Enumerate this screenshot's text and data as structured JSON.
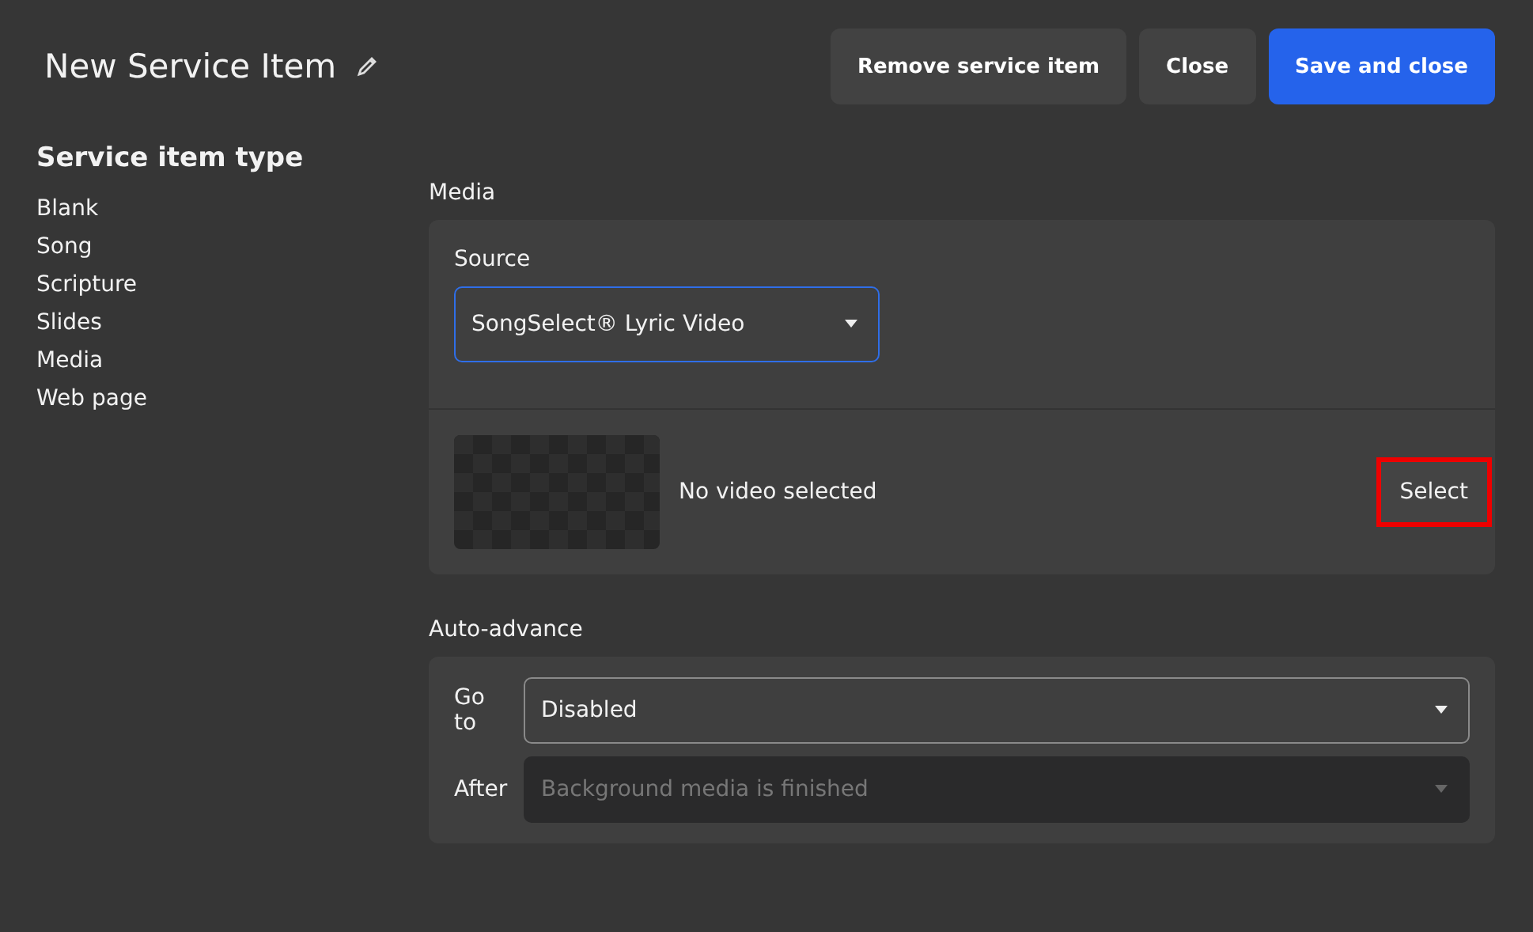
{
  "header": {
    "title": "New Service Item",
    "buttons": [
      {
        "label": "Remove service item",
        "kind": "secondary"
      },
      {
        "label": "Close",
        "kind": "secondary"
      },
      {
        "label": "Save and close",
        "kind": "primary"
      }
    ]
  },
  "sidebar": {
    "heading": "Service item type",
    "items": [
      "Blank",
      "Song",
      "Scripture",
      "Slides",
      "Media",
      "Web page"
    ]
  },
  "media": {
    "label": "Media",
    "source": {
      "label": "Source",
      "value": "SongSelect® Lyric Video",
      "focused": true
    },
    "video": {
      "status": "No video selected",
      "button": "Select",
      "highlighted": true
    }
  },
  "auto_advance": {
    "label": "Auto-advance",
    "rows": [
      {
        "label": "Go to",
        "value": "Disabled",
        "disabled": false
      },
      {
        "label": "After",
        "value": "Background media is finished",
        "disabled": true
      }
    ]
  }
}
